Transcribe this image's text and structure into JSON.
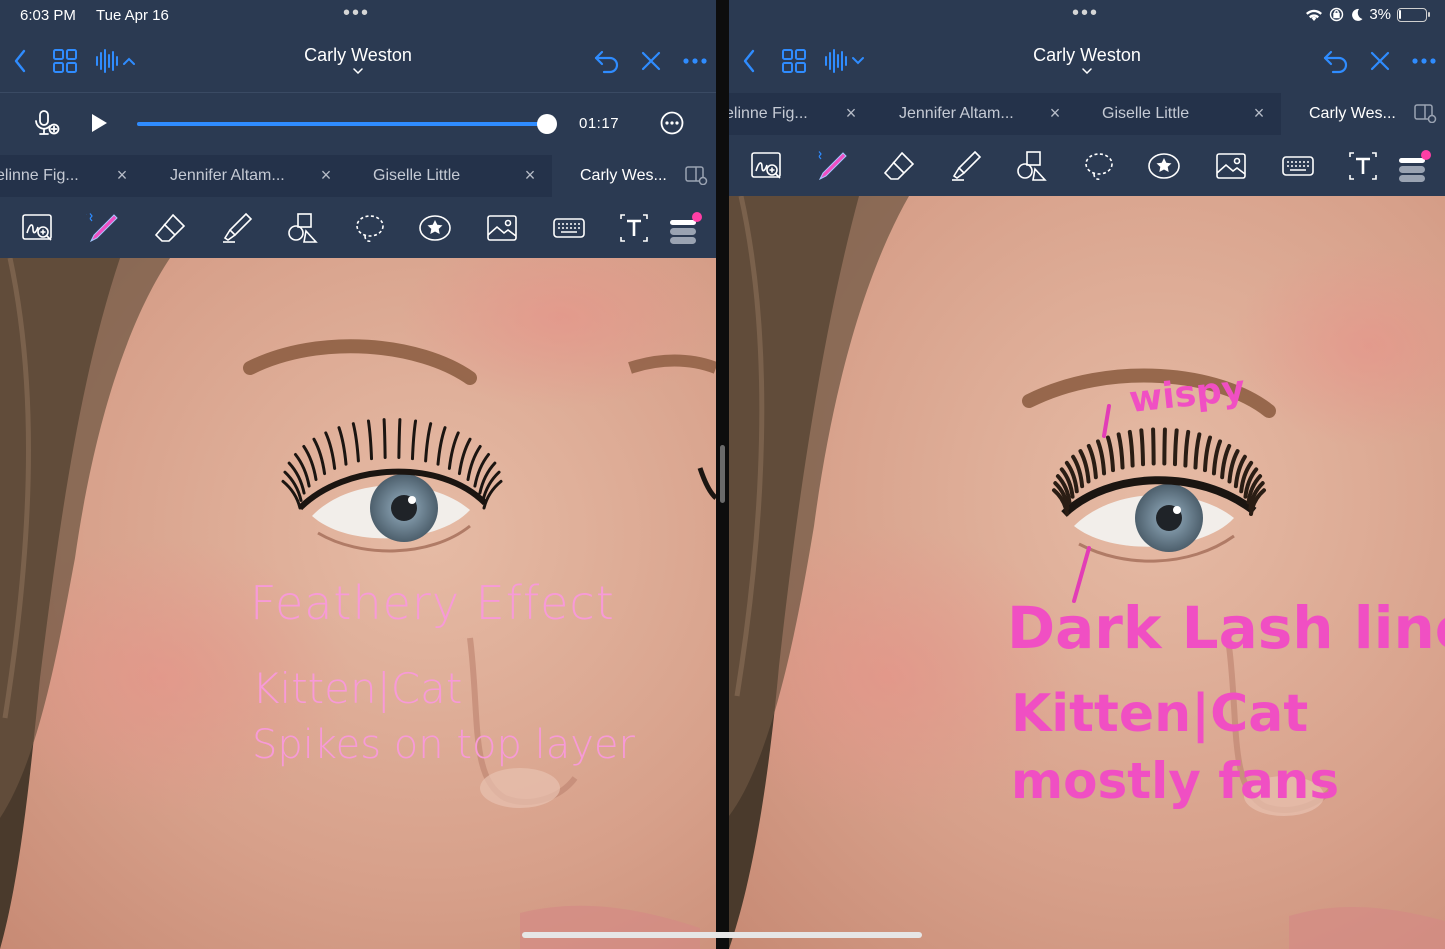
{
  "status_bar": {
    "time": "6:03 PM",
    "date": "Tue Apr 16",
    "multitask_dots": "•••",
    "battery_percent": "3%",
    "battery_level": 0.03
  },
  "left_pane": {
    "title": "Carly Weston",
    "audio": {
      "time": "01:17",
      "progress": 0.99
    },
    "tabs": [
      {
        "label": "elinne Fig..."
      },
      {
        "label": "Jennifer Altam..."
      },
      {
        "label": "Giselle Little"
      },
      {
        "label": "Carly Wes..."
      }
    ],
    "tab_close": "×",
    "handwriting": {
      "line1": "Feathery Effect",
      "line2": "Kitten|Cat",
      "line3": "Spikes on top layer"
    }
  },
  "right_pane": {
    "title": "Carly Weston",
    "tabs": [
      {
        "label": "elinne Fig..."
      },
      {
        "label": "Jennifer Altam..."
      },
      {
        "label": "Giselle Little"
      },
      {
        "label": "Carly Wes..."
      }
    ],
    "tab_close": "×",
    "handwriting": {
      "label_top": "wispy",
      "line1": "Dark Lash line",
      "line2": "Kitten|Cat",
      "line3": "mostly fans"
    }
  },
  "colors": {
    "accent": "#2f8cff",
    "toolbar_bg": "#2b3a52",
    "tab_bg": "#24324a",
    "ink_light": "#f79ad8",
    "ink_bold": "#f04fc3",
    "pen_dot": "#ff3ea5"
  },
  "icons": [
    "back-chevron-icon",
    "grid-view-icon",
    "audio-waveform-icon",
    "undo-icon",
    "close-icon",
    "more-icon",
    "mic-plus-icon",
    "play-icon",
    "options-circle-icon",
    "sidebar-icon",
    "zoom-write-icon",
    "pen-icon",
    "eraser-icon",
    "highlighter-icon",
    "shapes-icon",
    "lasso-icon",
    "sticker-icon",
    "image-icon",
    "keyboard-icon",
    "text-box-icon",
    "tool-settings-icon"
  ]
}
